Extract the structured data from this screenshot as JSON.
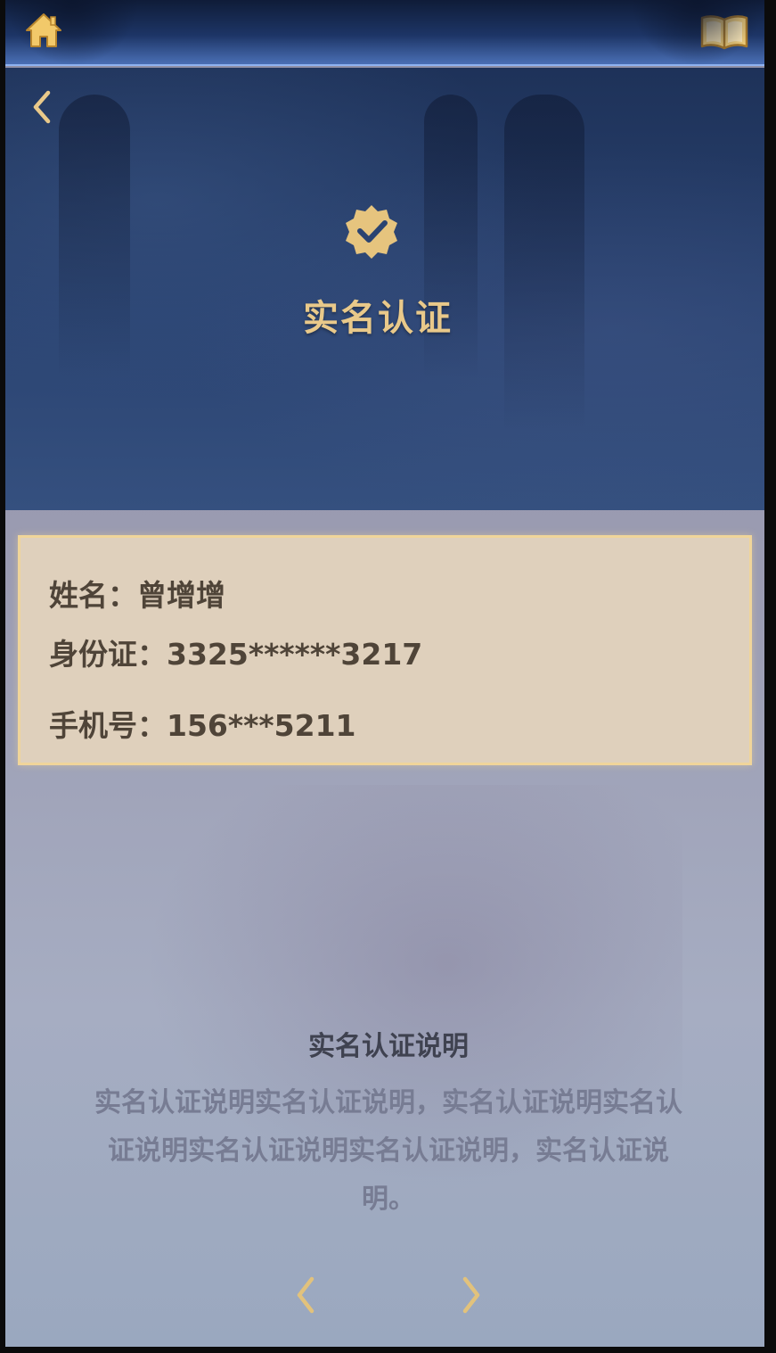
{
  "header": {
    "home_icon": "home-icon",
    "book_icon": "book-icon"
  },
  "hero": {
    "back_icon": "chevron-left-icon",
    "badge_icon": "verified-badge-icon",
    "title": "实名认证"
  },
  "info": {
    "name_label": "姓名：",
    "name_value": "曾增增",
    "id_label": "身份证：",
    "id_value": "3325******3217",
    "phone_label": "手机号：",
    "phone_value": "156***5211"
  },
  "explanation": {
    "title": "实名认证说明",
    "body": "实名认证说明实名认证说明，实名认证说明实名认证说明实名认证说明实名认证说明，实名认证说明。"
  },
  "pager": {
    "prev_icon": "chevron-left-icon",
    "next_icon": "chevron-right-icon"
  },
  "colors": {
    "gold": "#e9c98a",
    "card_bg": "#dfd0bc",
    "card_border": "#f0d59a",
    "header_bg": "#1d3566"
  }
}
